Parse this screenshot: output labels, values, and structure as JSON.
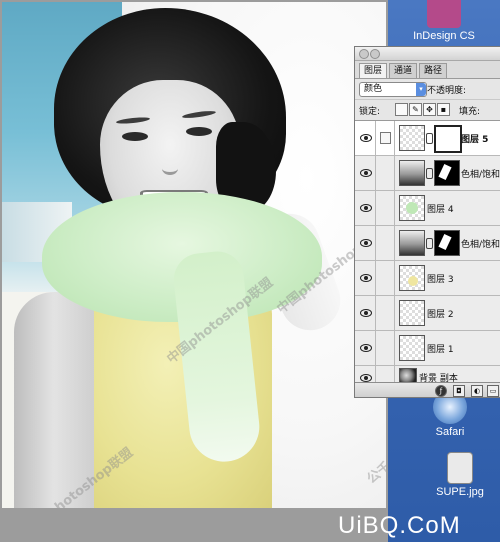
{
  "desktop": {
    "icons": [
      {
        "name": "indesign",
        "label": "InDesign CS"
      },
      {
        "name": "safari",
        "label": "Safari"
      },
      {
        "name": "supe",
        "label": "SUPE.jpg"
      }
    ]
  },
  "layers_panel": {
    "tabs": [
      "图层",
      "通道",
      "路径"
    ],
    "blend_mode": "颜色",
    "opacity_label": "不透明度:",
    "lock_label": "锁定:",
    "fill_label": "填充:",
    "layers": [
      {
        "name": "图层 5",
        "selected": true,
        "visible": true
      },
      {
        "name": "色相/饱和",
        "adjustment": true,
        "visible": true
      },
      {
        "name": "图层 4",
        "visible": true
      },
      {
        "name": "色相/饱和",
        "adjustment": true,
        "visible": true
      },
      {
        "name": "图层 3",
        "visible": true
      },
      {
        "name": "图层 2",
        "visible": true
      },
      {
        "name": "图层 1",
        "visible": true
      },
      {
        "name": "背景 副本",
        "visible": true
      }
    ]
  },
  "watermarks": {
    "photo_text": "中国photoshop联盟",
    "photo_text_short": "公千兔",
    "site": "UiBQ.CoM"
  }
}
